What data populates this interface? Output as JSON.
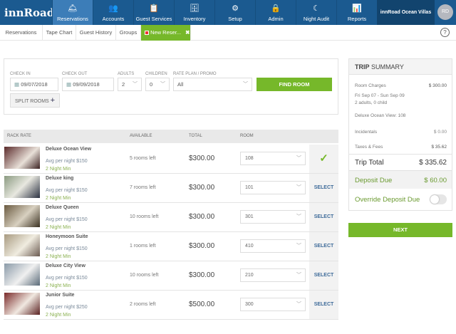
{
  "app": {
    "logo": "innRoad",
    "hotel": "innRoad Ocean Villas",
    "avatar": "RD"
  },
  "nav": [
    {
      "label": "Reservations",
      "icon": "bell-icon",
      "glyph": "🛎"
    },
    {
      "label": "Accounts",
      "icon": "users-icon",
      "glyph": "👥"
    },
    {
      "label": "Guest Services",
      "icon": "clipboard-icon",
      "glyph": "📋"
    },
    {
      "label": "Inventory",
      "icon": "inventory-icon",
      "glyph": "🗄"
    },
    {
      "label": "Setup",
      "icon": "gear-icon",
      "glyph": "⚙"
    },
    {
      "label": "Admin",
      "icon": "lock-icon",
      "glyph": "🔒"
    },
    {
      "label": "Night Audit",
      "icon": "moon-icon",
      "glyph": "☾"
    },
    {
      "label": "Reports",
      "icon": "bar-chart-icon",
      "glyph": "📊"
    }
  ],
  "subtabs": [
    "Reservations",
    "Tape Chart",
    "Guest History",
    "Groups",
    "New Reser..."
  ],
  "help": "?",
  "search": {
    "check_in_label": "CHECK IN",
    "check_in": "09/07/2018",
    "check_out_label": "CHECK OUT",
    "check_out": "09/09/2018",
    "adults_label": "ADULTS",
    "adults": "2",
    "children_label": "CHILDREN",
    "children": "0",
    "rate_label": "RATE PLAN / PROMO",
    "rate": "All",
    "find": "FIND ROOM",
    "split": "SPLIT ROOMS"
  },
  "table": {
    "headers": [
      "RACK RATE",
      "AVAILABLE",
      "TOTAL",
      "ROOM"
    ],
    "select_label": "SELECT",
    "rows": [
      {
        "name": "Deluxe Ocean View",
        "avg": "Avg per night $150",
        "min": "2 Night Min",
        "available": "5 rooms left",
        "total": "$300.00",
        "room": "108",
        "selected": true
      },
      {
        "name": "Deluxe king",
        "avg": "Avg per night $150",
        "min": "2 Night Min",
        "available": "7 rooms left",
        "total": "$300.00",
        "room": "101",
        "selected": false
      },
      {
        "name": "Deluxe Queen",
        "avg": "Avg per night $150",
        "min": "2 Night Min",
        "available": "10 rooms left",
        "total": "$300.00",
        "room": "301",
        "selected": false
      },
      {
        "name": "Honeymoon Suite",
        "avg": "Avg per night $150",
        "min": "2 Night Min",
        "available": "1 rooms left",
        "total": "$300.00",
        "room": "410",
        "selected": false
      },
      {
        "name": "Deluxe City View",
        "avg": "Avg per night $150",
        "min": "2 Night Min",
        "available": "10 rooms left",
        "total": "$300.00",
        "room": "210",
        "selected": false
      },
      {
        "name": "Junior Suite",
        "avg": "Avg per night $250",
        "min": "2 Night Min",
        "available": "2 rooms left",
        "total": "$500.00",
        "room": "300",
        "selected": false
      }
    ]
  },
  "summary": {
    "title_bold": "TRIP",
    "title_rest": " SUMMARY",
    "room_charges_label": "Room Charges",
    "room_charges": "$ 300.00",
    "dates": "Fri Sep 07 - Sun Sep 09",
    "guests": "2 adults, 0 child",
    "room": "Deluxe Ocean View: 108",
    "incidentals_label": "Incidentals",
    "incidentals": "$ 0.00",
    "taxes_label": "Taxes & Fees",
    "taxes": "$ 35.62",
    "total_label": "Trip Total",
    "total": "$ 335.62",
    "deposit_label": "Deposit Due",
    "deposit": "$ 60.00",
    "override_label": "Override Deposit Due",
    "override_on": false,
    "next": "NEXT"
  },
  "colors": {
    "nav": "#1b5a90",
    "active": "#3c7db8",
    "green": "#76b82a"
  }
}
